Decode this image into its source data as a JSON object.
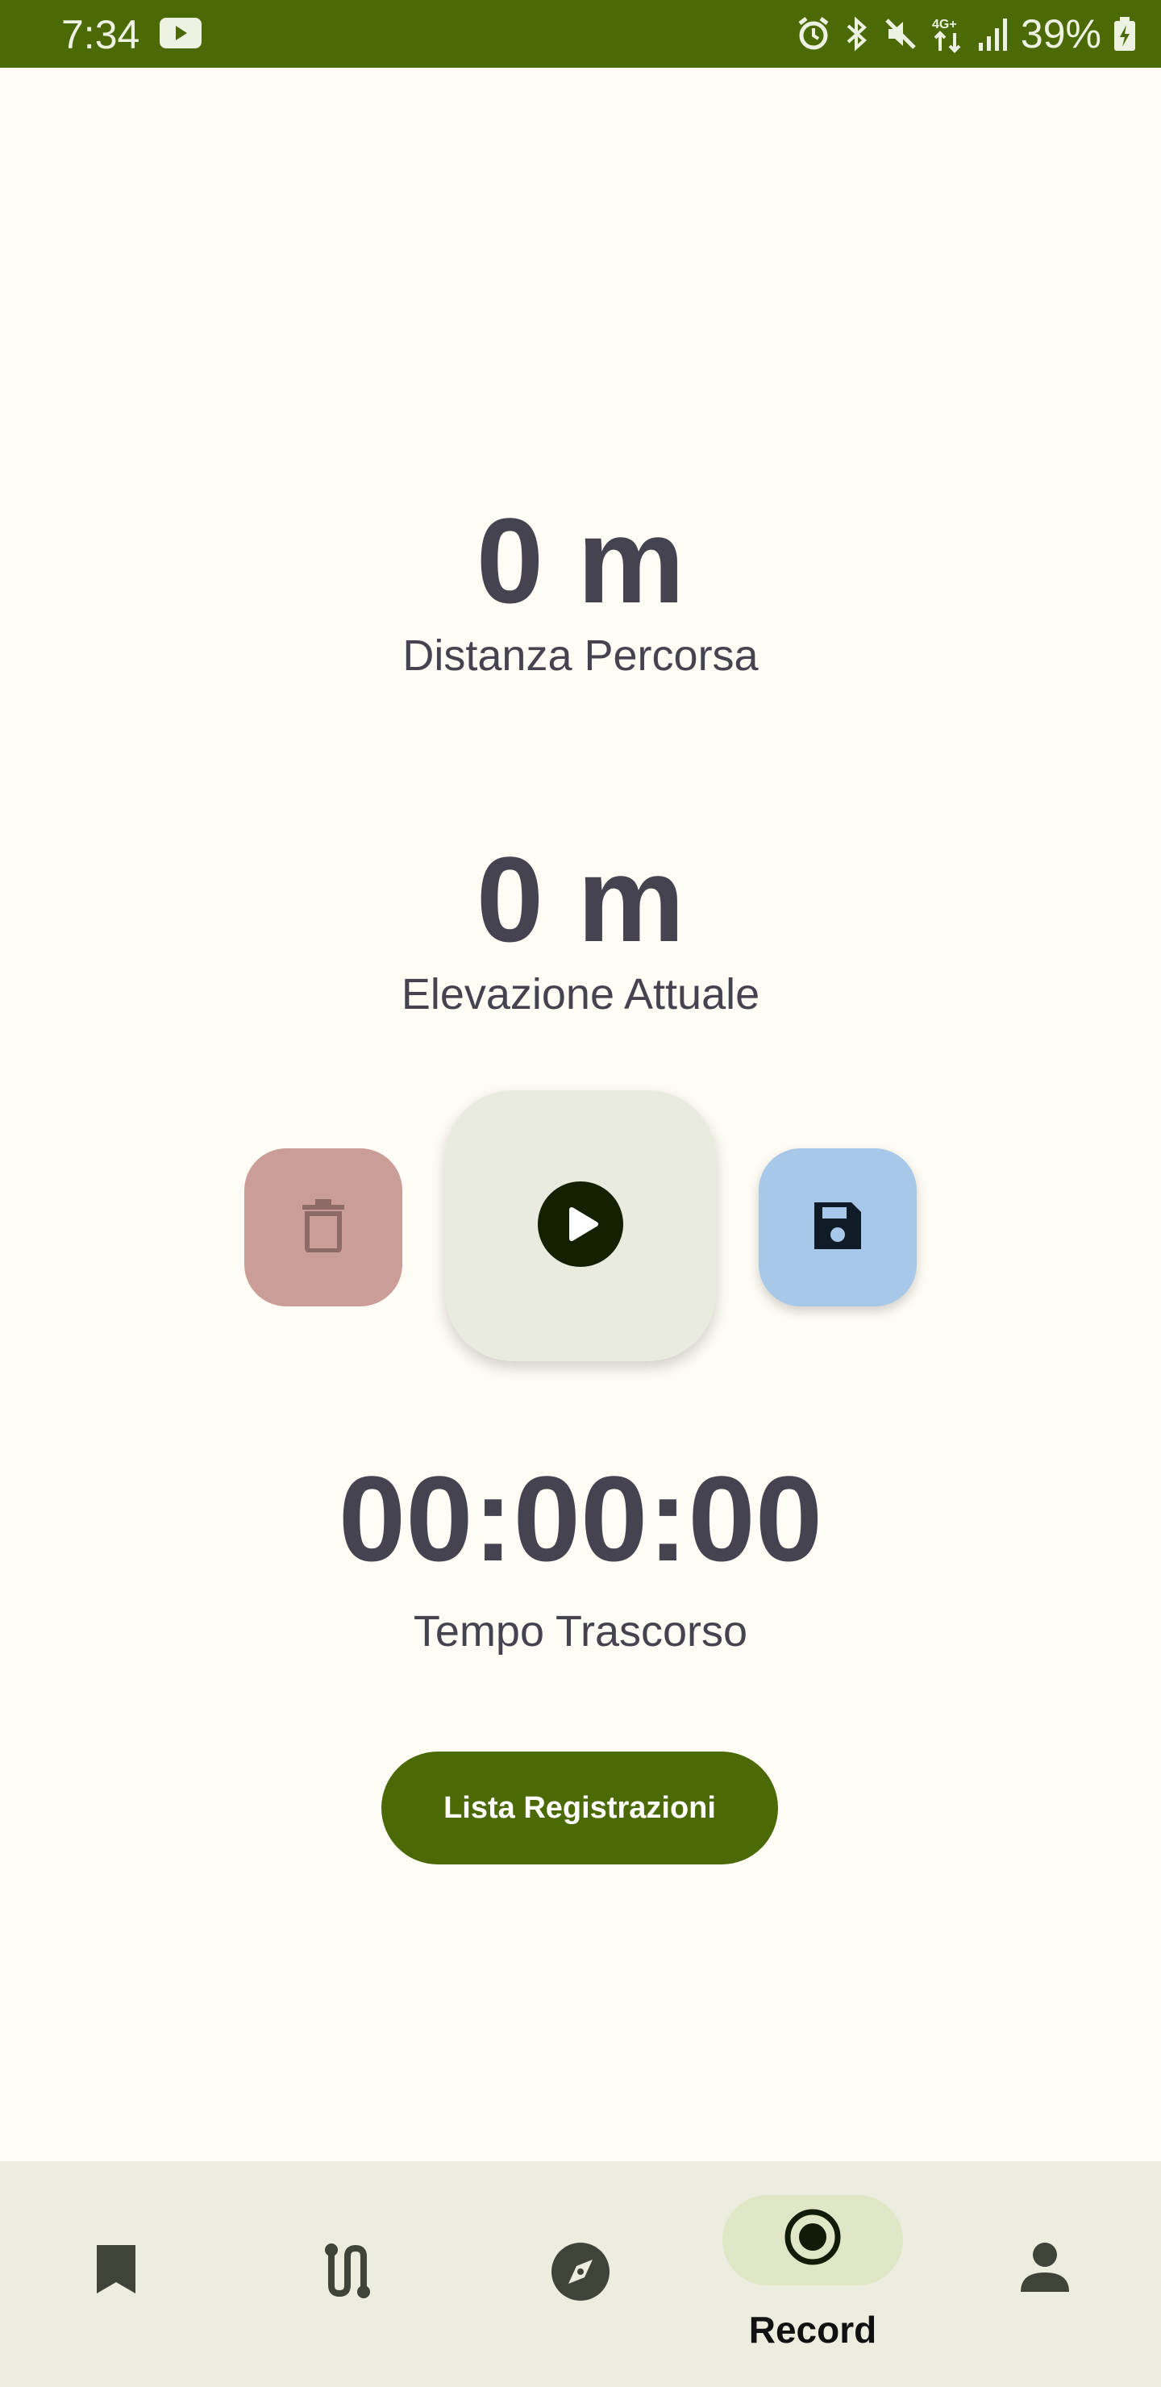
{
  "status_bar": {
    "time": "7:34",
    "battery": "39%",
    "network": "4G+"
  },
  "metrics": {
    "distance_value": "0 m",
    "distance_label": "Distanza Percorsa",
    "elevation_value": "0 m",
    "elevation_label": "Elevazione Attuale",
    "elapsed_value": "00:00:00",
    "elapsed_label": "Tempo Trascorso"
  },
  "actions": {
    "list_button": "Lista Registrazioni"
  },
  "nav": {
    "items": [
      {
        "icon": "bookmark-icon"
      },
      {
        "icon": "route-icon"
      },
      {
        "icon": "compass-icon"
      },
      {
        "icon": "record-icon",
        "label": "Record",
        "active": true
      },
      {
        "icon": "person-icon"
      }
    ]
  },
  "colors": {
    "primary": "#4b6a06",
    "background": "#fefcf4",
    "delete": "#cb9d99",
    "save": "#a7c8e8"
  }
}
